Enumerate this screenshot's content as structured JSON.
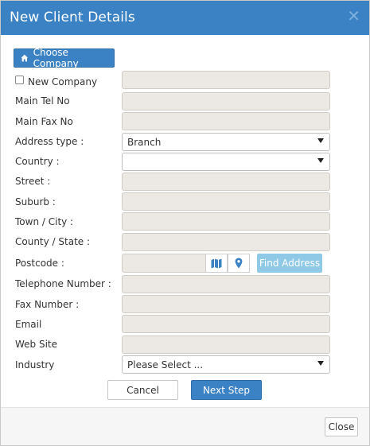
{
  "dialog": {
    "title": "New Client Details",
    "close_symbol": "✕"
  },
  "toolbar": {
    "choose_company_label": "Choose Company",
    "choose_company_icon": "home-icon"
  },
  "form": {
    "new_company_label": "New Company",
    "main_tel_label": "Main Tel No",
    "main_fax_label": "Main Fax No",
    "address_type_label": "Address type :",
    "address_type_value": "Branch",
    "country_label": "Country :",
    "country_value": "",
    "street_label": "Street :",
    "suburb_label": "Suburb :",
    "town_label": "Town / City :",
    "county_label": "County / State :",
    "postcode_label": "Postcode :",
    "postcode_map_icon": "map-icon",
    "postcode_marker_icon": "map-marker-icon",
    "find_address_label": "Find Address",
    "telephone_label": "Telephone Number :",
    "fax_label": "Fax Number :",
    "email_label": "Email",
    "website_label": "Web Site",
    "industry_label": "Industry",
    "industry_value": "Please Select ..."
  },
  "actions": {
    "cancel_label": "Cancel",
    "next_label": "Next Step"
  },
  "footer": {
    "close_label": "Close"
  },
  "colors": {
    "primary": "#3a82c4",
    "disabled_button": "#8fc9e6",
    "input_disabled_bg": "#ece9e4"
  }
}
